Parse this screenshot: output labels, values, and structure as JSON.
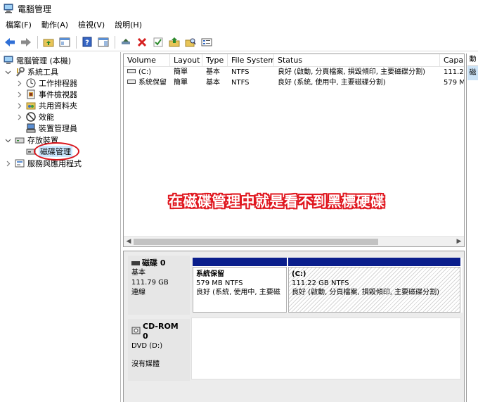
{
  "window": {
    "title": "電腦管理"
  },
  "menu": [
    {
      "label": "檔案(F)"
    },
    {
      "label": "動作(A)"
    },
    {
      "label": "檢視(V)"
    },
    {
      "label": "說明(H)"
    }
  ],
  "tree": {
    "root": "電腦管理 (本機)",
    "system_tools": "系統工具",
    "task_scheduler": "工作排程器",
    "event_viewer": "事件檢視器",
    "shared_folders": "共用資料夾",
    "performance": "效能",
    "device_manager": "裝置管理員",
    "storage": "存放裝置",
    "disk_management": "磁碟管理",
    "services": "服務與應用程式"
  },
  "volume_list": {
    "columns": [
      "Volume",
      "Layout",
      "Type",
      "File System",
      "Status",
      "Capa"
    ],
    "rows": [
      {
        "volume": "(C:)",
        "layout": "簡單",
        "type": "基本",
        "fs": "NTFS",
        "status": "良好 (啟動, 分頁檔案, 損毀傾印, 主要磁碟分割)",
        "capacity": "111.2"
      },
      {
        "volume": "系統保留",
        "layout": "簡單",
        "type": "基本",
        "fs": "NTFS",
        "status": "良好 (系統, 使用中, 主要磁碟分割)",
        "capacity": "579 M"
      }
    ]
  },
  "annotation": "在磁碟管理中就是看不到黑標硬碟",
  "right_panel": {
    "tab1": "動",
    "tab2": "磁"
  },
  "disks": {
    "disk0": {
      "name": "磁碟 0",
      "type": "基本",
      "size": "111.79 GB",
      "state": "連線",
      "partitions": [
        {
          "name": "系統保留",
          "size": "579 MB NTFS",
          "status": "良好 (系統, 使用中, 主要磁"
        },
        {
          "name": "(C:)",
          "size": "111.22 GB NTFS",
          "status": "良好 (啟動, 分頁檔案, 損毀傾印, 主要磁碟分割)"
        }
      ]
    },
    "cdrom0": {
      "name": "CD-ROM 0",
      "type": "DVD (D:)",
      "state": "沒有媒體"
    }
  },
  "colors": {
    "partition_bar": "#0a1e8c",
    "annotation_red": "#e0161e",
    "highlight_circle": "#d8141c"
  }
}
